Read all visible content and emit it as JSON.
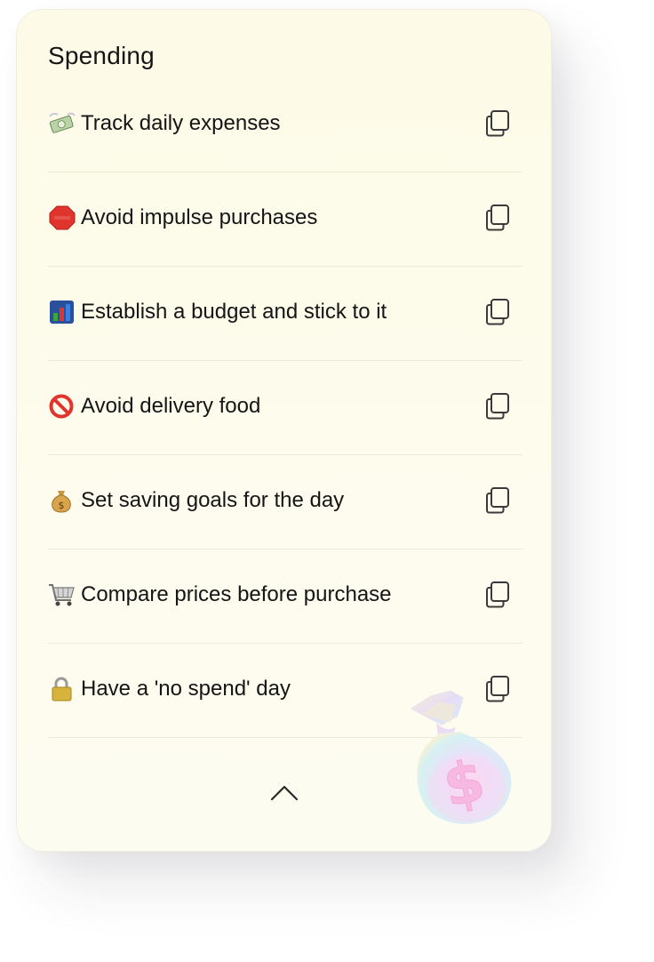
{
  "card": {
    "title": "Spending"
  },
  "items": [
    {
      "emoji": "money-with-wings-icon",
      "label": "Track daily expenses"
    },
    {
      "emoji": "stop-sign-icon",
      "label": "Avoid impulse purchases"
    },
    {
      "emoji": "bar-chart-icon",
      "label": "Establish a budget and stick to it"
    },
    {
      "emoji": "prohibited-icon",
      "label": "Avoid delivery food"
    },
    {
      "emoji": "money-bag-icon",
      "label": "Set saving goals for the day"
    },
    {
      "emoji": "shopping-cart-icon",
      "label": "Compare prices before purchase"
    },
    {
      "emoji": "lock-icon",
      "label": "Have a 'no spend' day"
    }
  ],
  "colors": {
    "card_bg": "#fdfbe7",
    "text": "#151515",
    "divider": "#ece9d6",
    "icon_stroke": "#3a3a3a"
  }
}
